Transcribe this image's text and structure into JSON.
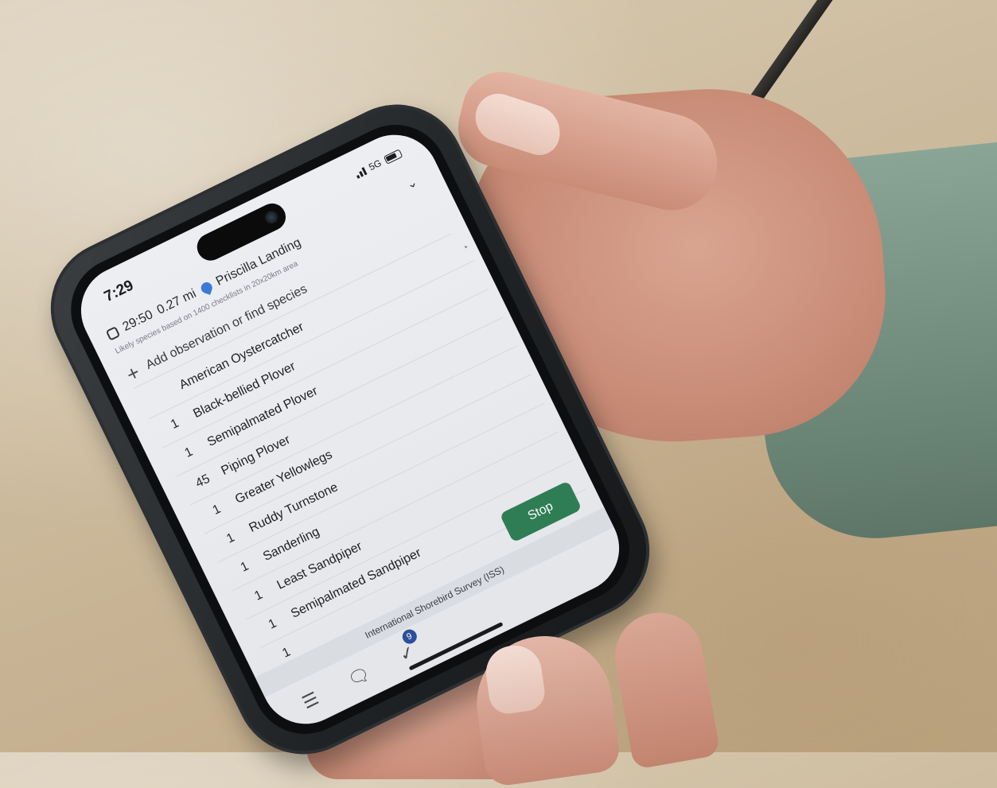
{
  "status": {
    "time": "7:29",
    "network": "5G",
    "signal_icon": "signal-bars-icon",
    "battery_icon": "battery-icon"
  },
  "checklist": {
    "elapsed": "29:50",
    "distance": "0.27 mi",
    "location": "Priscilla Landing",
    "collapse_icon": "chevron-down-icon",
    "likely_species_note": "Likely species based on 1400 checklists in 20x20km area",
    "add_placeholder": "Add observation or find species",
    "species": [
      {
        "count": "",
        "name": "American Oystercatcher"
      },
      {
        "count": "1",
        "name": "Black-bellied Plover"
      },
      {
        "count": "1",
        "name": "Semipalmated Plover"
      },
      {
        "count": "45",
        "name": "Piping Plover"
      },
      {
        "count": "1",
        "name": "Greater Yellowlegs"
      },
      {
        "count": "1",
        "name": "Ruddy Turnstone"
      },
      {
        "count": "1",
        "name": "Sanderling"
      },
      {
        "count": "1",
        "name": "Least Sandpiper"
      },
      {
        "count": "1",
        "name": "Semipalmated Sandpiper"
      },
      {
        "count": "1",
        "name": ""
      }
    ],
    "stop_label": "Stop",
    "protocol": "International Shorebird Survey (ISS)",
    "tabs": {
      "menu_icon": "hamburger-icon",
      "comment_icon": "speech-bubble-icon",
      "check_icon": "checkmark-icon",
      "check_badge": "9"
    }
  },
  "colors": {
    "stop_button": "#2f7d55",
    "location_pin": "#3a7bd5",
    "badge": "#2b4f9c"
  }
}
